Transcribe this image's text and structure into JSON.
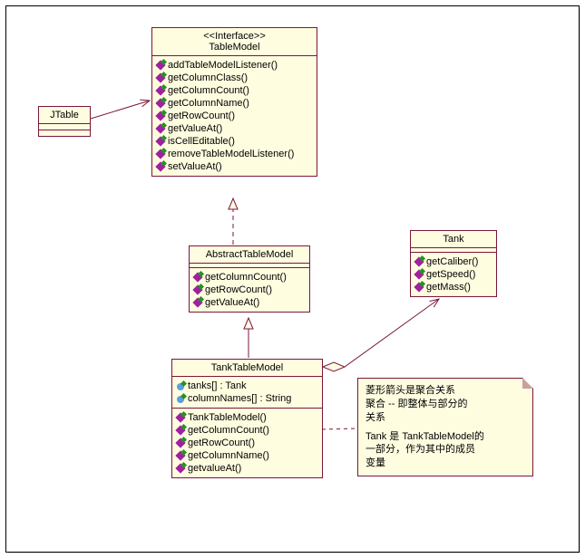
{
  "jtable": {
    "name": "JTable"
  },
  "tablemodel": {
    "stereotype": "<<Interface>>",
    "name": "TableModel",
    "ops": [
      "addTableModelListener()",
      "getColumnClass()",
      "getColumnCount()",
      "getColumnName()",
      "getRowCount()",
      "getValueAt()",
      "isCellEditable()",
      "removeTableModelListener()",
      "setValueAt()"
    ]
  },
  "abstract_tm": {
    "name": "AbstractTableModel",
    "ops": [
      "getColumnCount()",
      "getRowCount()",
      "getValueAt()"
    ]
  },
  "tank_tm": {
    "name": "TankTableModel",
    "attrs": [
      "tanks[] : Tank",
      "columnNames[] : String"
    ],
    "ops": [
      "TankTableModel()",
      "getColumnCount()",
      "getRowCount()",
      "getColumnName()",
      "getvalueAt()"
    ]
  },
  "tank": {
    "name": "Tank",
    "ops": [
      "getCaliber()",
      "getSpeed()",
      "getMass()"
    ]
  },
  "note": {
    "l1": "菱形箭头是聚合关系",
    "l2": "聚合 -- 即整体与部分的",
    "l3": "关系",
    "l4": "Tank 是 TankTableModel的",
    "l5": "一部分，作为其中的成员",
    "l6": "变量"
  }
}
